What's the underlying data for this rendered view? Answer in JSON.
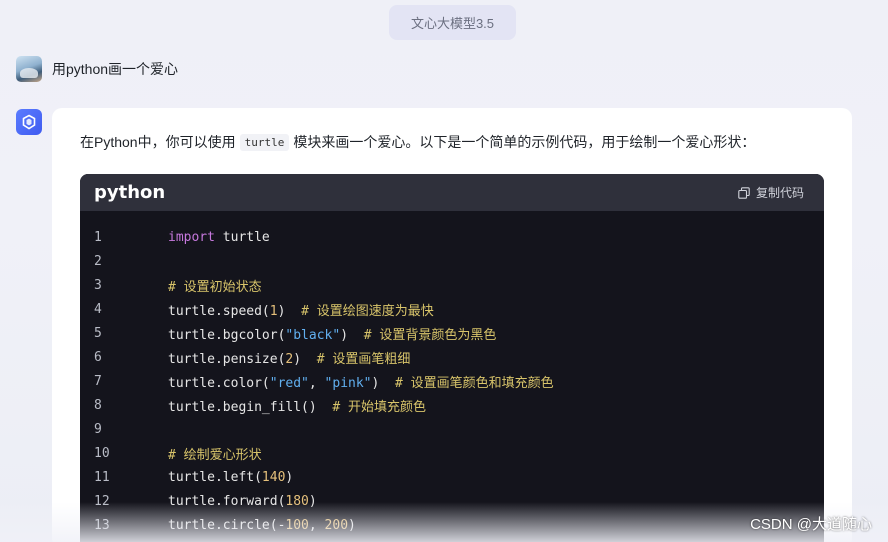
{
  "model_label": "文心大模型3.5",
  "user": {
    "message": "用python画一个爱心"
  },
  "answer": {
    "intro_before": "在Python中，你可以使用",
    "intro_code": "turtle",
    "intro_after": "模块来画一个爱心。以下是一个简单的示例代码，用于绘制一个爱心形状："
  },
  "code": {
    "language": "python",
    "copy_label": "复制代码",
    "lines": [
      {
        "n": "1",
        "tokens": [
          {
            "t": "kw",
            "v": "import"
          },
          {
            "t": "p",
            "v": " turtle"
          }
        ]
      },
      {
        "n": "2",
        "tokens": []
      },
      {
        "n": "3",
        "tokens": [
          {
            "t": "cm",
            "v": "# 设置初始状态"
          }
        ]
      },
      {
        "n": "4",
        "tokens": [
          {
            "t": "p",
            "v": "turtle.speed("
          },
          {
            "t": "num",
            "v": "1"
          },
          {
            "t": "p",
            "v": ")  "
          },
          {
            "t": "cm",
            "v": "# 设置绘图速度为最快"
          }
        ]
      },
      {
        "n": "5",
        "tokens": [
          {
            "t": "p",
            "v": "turtle.bgcolor("
          },
          {
            "t": "str",
            "v": "\"black\""
          },
          {
            "t": "p",
            "v": ")  "
          },
          {
            "t": "cm",
            "v": "# 设置背景颜色为黑色"
          }
        ]
      },
      {
        "n": "6",
        "tokens": [
          {
            "t": "p",
            "v": "turtle.pensize("
          },
          {
            "t": "num",
            "v": "2"
          },
          {
            "t": "p",
            "v": ")  "
          },
          {
            "t": "cm",
            "v": "# 设置画笔粗细"
          }
        ]
      },
      {
        "n": "7",
        "tokens": [
          {
            "t": "p",
            "v": "turtle.color("
          },
          {
            "t": "str",
            "v": "\"red\""
          },
          {
            "t": "p",
            "v": ", "
          },
          {
            "t": "str",
            "v": "\"pink\""
          },
          {
            "t": "p",
            "v": ")  "
          },
          {
            "t": "cm",
            "v": "# 设置画笔颜色和填充颜色"
          }
        ]
      },
      {
        "n": "8",
        "tokens": [
          {
            "t": "p",
            "v": "turtle.begin_fill()  "
          },
          {
            "t": "cm",
            "v": "# 开始填充颜色"
          }
        ]
      },
      {
        "n": "9",
        "tokens": []
      },
      {
        "n": "10",
        "tokens": [
          {
            "t": "cm",
            "v": "# 绘制爱心形状"
          }
        ]
      },
      {
        "n": "11",
        "tokens": [
          {
            "t": "p",
            "v": "turtle.left("
          },
          {
            "t": "num",
            "v": "140"
          },
          {
            "t": "p",
            "v": ")"
          }
        ]
      },
      {
        "n": "12",
        "tokens": [
          {
            "t": "p",
            "v": "turtle.forward("
          },
          {
            "t": "num",
            "v": "180"
          },
          {
            "t": "p",
            "v": ")"
          }
        ]
      },
      {
        "n": "13",
        "tokens": [
          {
            "t": "p",
            "v": "turtle.circle(-"
          },
          {
            "t": "num",
            "v": "100"
          },
          {
            "t": "p",
            "v": ", "
          },
          {
            "t": "num",
            "v": "200"
          },
          {
            "t": "p",
            "v": ")"
          }
        ]
      }
    ]
  },
  "watermark": "CSDN @大道随心"
}
